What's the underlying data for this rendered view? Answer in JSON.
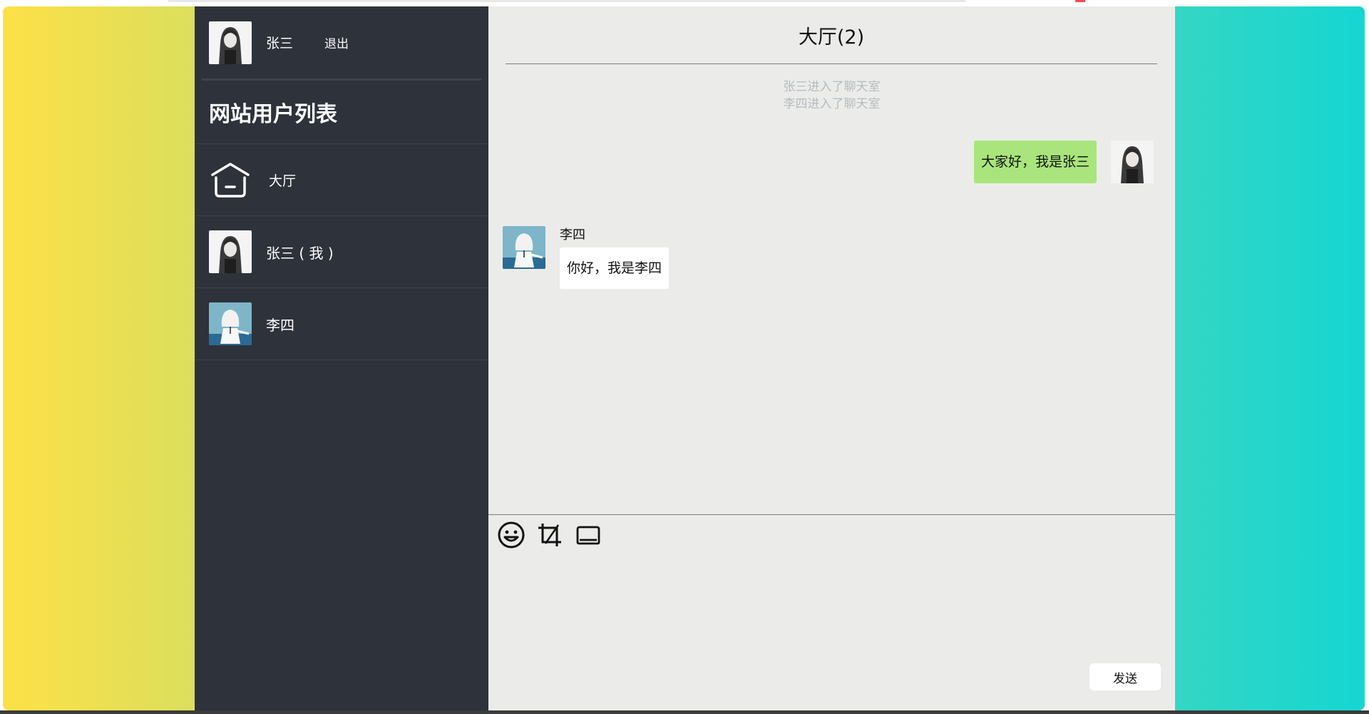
{
  "current_user": {
    "name": "张三",
    "logout_label": "退出"
  },
  "sidebar": {
    "title": "网站用户列表",
    "items": [
      {
        "label": "大厅",
        "icon": "home-icon"
      },
      {
        "label": "张三 ( 我 )",
        "icon": "avatar-dark-hair"
      },
      {
        "label": "李四",
        "icon": "avatar-white-hair"
      }
    ]
  },
  "chat": {
    "title": "大厅(2)",
    "system_messages": [
      "张三进入了聊天室",
      "李四进入了聊天室"
    ],
    "messages": [
      {
        "sender": "张三",
        "text": "大家好，我是张三",
        "self": true
      },
      {
        "sender": "李四",
        "text": "你好，我是李四",
        "self": false
      }
    ],
    "tools": [
      "emoji-icon",
      "crop-icon",
      "folder-icon"
    ],
    "send_label": "发送"
  },
  "colors": {
    "sidebar_bg": "#2e323a",
    "chat_bg": "#ebecea",
    "self_bubble": "#a9e57c",
    "other_bubble": "#ffffff",
    "gradient_left": "#fde047",
    "gradient_right": "#15d6d2"
  }
}
